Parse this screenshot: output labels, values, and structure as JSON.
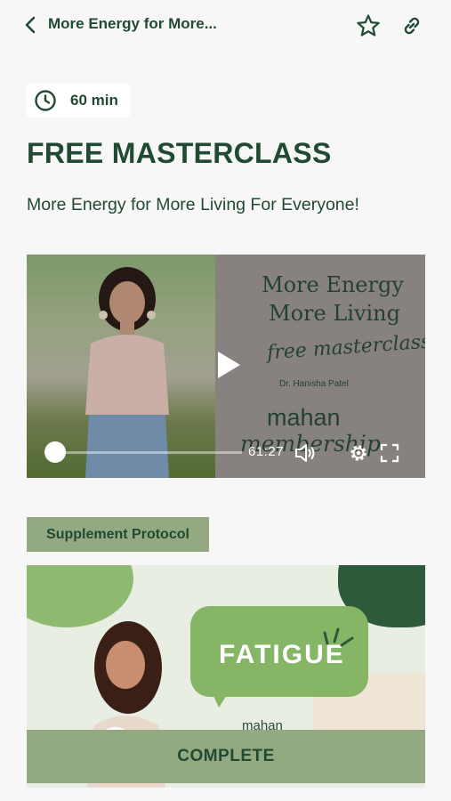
{
  "header": {
    "title": "More Energy for More...",
    "back_icon": "chevron-left-icon",
    "favorite_icon": "star-icon",
    "share_icon": "link-icon"
  },
  "lesson": {
    "duration": "60 min",
    "duration_icon": "clock-icon",
    "title": "FREE MASTERCLASS",
    "subtitle": "More Energy for More Living For Everyone!"
  },
  "video": {
    "poster_line1": "More Energy",
    "poster_line2": "More Living",
    "poster_script": "free masterclass",
    "poster_doctor": "Dr. Hanisha Patel",
    "poster_brand": "mahan",
    "poster_brand2": "membership",
    "time_remaining": "61:27",
    "progress": 0.0
  },
  "section": {
    "tag_label": "Supplement Protocol",
    "thumbnail_word": "FATIGUE",
    "thumbnail_brand": "mahan"
  },
  "actions": {
    "complete_label": "COMPLETE"
  },
  "colors": {
    "primary_text": "#214a33",
    "accent_green": "#93a981",
    "background": "#f7f7f7"
  }
}
